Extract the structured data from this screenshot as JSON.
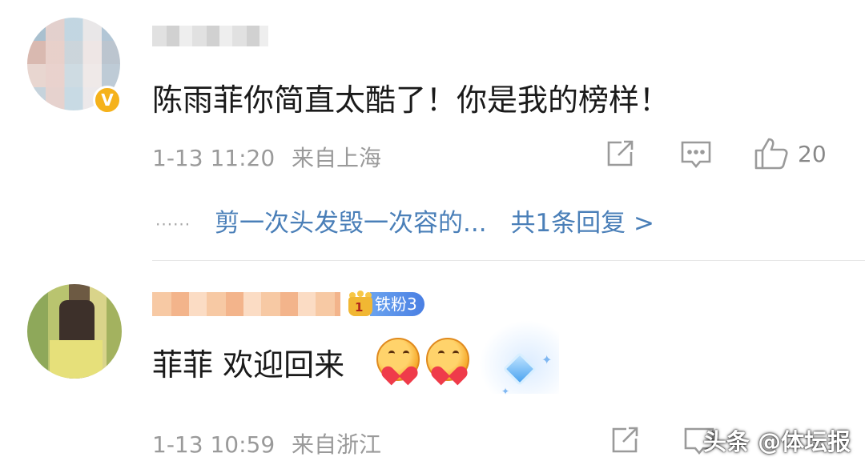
{
  "comments": [
    {
      "text": "陈雨菲你简直太酷了！你是我的榜样！",
      "time": "1-13 11:20",
      "location": "来自上海",
      "likes": "20",
      "reply_preview": "剪一次头发毁一次容的...",
      "reply_count": "共1条回复 >",
      "reply_dots": "······",
      "verified_badge": "V"
    },
    {
      "fan_badge": "铁粉3",
      "crown_number": "1",
      "text": "菲菲 欢迎回来",
      "time": "1-13 10:59",
      "location": "来自浙江"
    }
  ],
  "watermark": "头条 @体坛报",
  "icons": [
    "share-icon",
    "comment-icon",
    "like-icon"
  ],
  "colors": {
    "link": "#4a7fb8",
    "meta": "#9a9a9a",
    "badge_gold": "#f5b21b",
    "fan_blue": "#4a7fe3"
  }
}
